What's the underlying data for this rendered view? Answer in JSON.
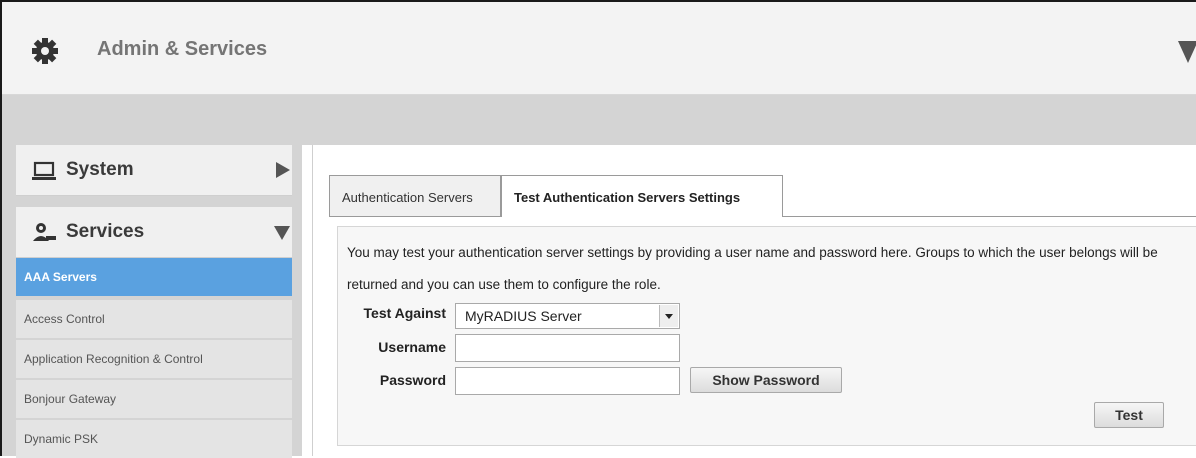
{
  "header": {
    "title": "Admin & Services"
  },
  "sidebar": {
    "sections": [
      {
        "label": "System",
        "icon": "laptop-icon",
        "state": "collapsed"
      },
      {
        "label": "Services",
        "icon": "services-icon",
        "state": "expanded"
      }
    ],
    "items": [
      {
        "label": "AAA Servers",
        "active": true
      },
      {
        "label": "Access Control"
      },
      {
        "label": "Application Recognition & Control"
      },
      {
        "label": "Bonjour Gateway"
      },
      {
        "label": "Dynamic PSK"
      }
    ]
  },
  "main": {
    "tabs": [
      {
        "label": "Authentication Servers"
      },
      {
        "label": "Test Authentication Servers Settings",
        "active": true
      }
    ],
    "description": "You may test your authentication server settings by providing a user name and password here. Groups to which the user belongs will be returned and you can use them to configure the role.",
    "form": {
      "test_against_label": "Test Against",
      "test_against_value": "MyRADIUS Server",
      "username_label": "Username",
      "username_value": "",
      "password_label": "Password",
      "password_value": "",
      "show_password_label": "Show Password",
      "test_label": "Test"
    }
  },
  "colors": {
    "active_item": "#5aa1e0",
    "header_bg": "#f3f3f3",
    "band": "#d4d4d4"
  }
}
